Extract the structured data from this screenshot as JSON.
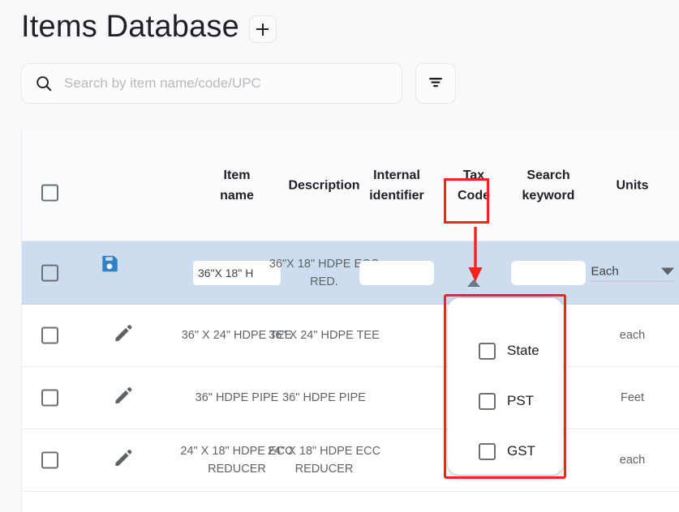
{
  "header": {
    "title": "Items Database",
    "add_button_label": "+",
    "add_icon": "plus-icon"
  },
  "search": {
    "placeholder": "Search by item name/code/UPC",
    "value": "",
    "icon": "search-icon",
    "filter_icon": "filter-icon"
  },
  "table": {
    "columns": [
      {
        "key": "select",
        "label": ""
      },
      {
        "key": "action",
        "label": ""
      },
      {
        "key": "item_name",
        "label": "Item name"
      },
      {
        "key": "description",
        "label": "Description"
      },
      {
        "key": "internal_identifier",
        "label": "Internal identifier"
      },
      {
        "key": "tax_code",
        "label": "Tax Code"
      },
      {
        "key": "search_keyword",
        "label": "Search keyword"
      },
      {
        "key": "units",
        "label": "Units"
      }
    ],
    "header_labels": {
      "item_name_line1": "Item",
      "item_name_line2": "name",
      "description": "Description",
      "internal_identifier_line1": "Internal",
      "internal_identifier_line2": "identifier",
      "tax_code_line1": "Tax",
      "tax_code_line2": "Code",
      "search_keyword_line1": "Search",
      "search_keyword_line2": "keyword",
      "units": "Units"
    },
    "rows": [
      {
        "mode": "edit",
        "selected": false,
        "save_icon": "save-icon",
        "cancel_icon": "cancel-icon",
        "item_name_value": "36\"X 18\" H",
        "description": "36\"X 18\" HDPE ECC RED.",
        "internal_identifier_value": "",
        "tax_code_value": "",
        "search_keyword_value": "",
        "units_value": "Each"
      },
      {
        "mode": "view",
        "selected": false,
        "edit_icon": "edit-pencil-icon",
        "item_name": "36\" X 24\" HDPE TEE",
        "description": "36\" X 24\" HDPE TEE",
        "internal_identifier": "",
        "tax_code": "",
        "search_keyword": "",
        "units": "each"
      },
      {
        "mode": "view",
        "selected": false,
        "edit_icon": "edit-pencil-icon",
        "item_name": "36\" HDPE PIPE",
        "description": "36\" HDPE PIPE",
        "internal_identifier": "",
        "tax_code": "",
        "search_keyword": "",
        "units": "Feet"
      },
      {
        "mode": "view",
        "selected": false,
        "edit_icon": "edit-pencil-icon",
        "item_name": "24\" X 18\" HDPE ECC REDUCER",
        "description": "24\" X 18\" HDPE ECC REDUCER",
        "internal_identifier": "",
        "tax_code": "",
        "search_keyword": "",
        "units": "each"
      }
    ]
  },
  "tax_dropdown": {
    "open": true,
    "options": [
      {
        "label": "State",
        "checked": false
      },
      {
        "label": "PST",
        "checked": false
      },
      {
        "label": "GST",
        "checked": false
      }
    ]
  },
  "annotations": {
    "color": "#f5221f",
    "highlight_tax_code_header": true,
    "highlight_tax_dropdown": true,
    "arrow_from": "tax-code-header",
    "arrow_to": "tax-code-dropdown-toggle"
  },
  "colors": {
    "edit_row_background": "#cddcee",
    "save_icon": "#3082c6",
    "cancel_icon": "#d32f2f",
    "annotation_red": "#f5221f",
    "page_background": "#f8f9fb"
  }
}
